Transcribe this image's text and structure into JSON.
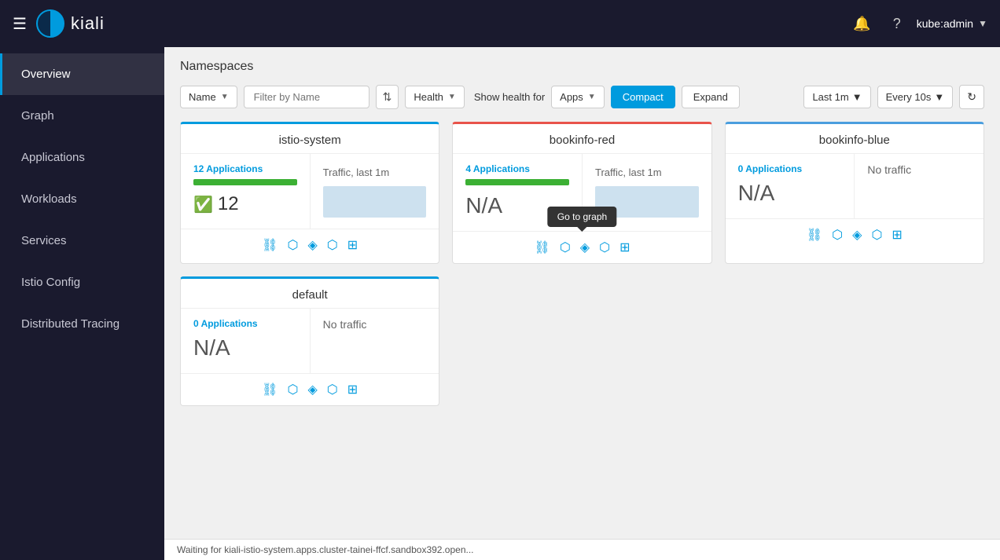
{
  "topnav": {
    "logo_text": "kiali",
    "user": "kube:admin",
    "notification_icon": "🔔",
    "help_icon": "?"
  },
  "sidebar": {
    "items": [
      {
        "id": "overview",
        "label": "Overview",
        "active": true
      },
      {
        "id": "graph",
        "label": "Graph",
        "active": false
      },
      {
        "id": "applications",
        "label": "Applications",
        "active": false
      },
      {
        "id": "workloads",
        "label": "Workloads",
        "active": false
      },
      {
        "id": "services",
        "label": "Services",
        "active": false
      },
      {
        "id": "istio-config",
        "label": "Istio Config",
        "active": false
      },
      {
        "id": "distributed-tracing",
        "label": "Distributed Tracing",
        "active": false
      }
    ]
  },
  "toolbar": {
    "name_label": "Name",
    "filter_placeholder": "Filter by Name",
    "health_label": "Health",
    "show_health_for": "Show health for",
    "apps_label": "Apps",
    "compact_label": "Compact",
    "expand_label": "Expand",
    "last_1m_label": "Last 1m",
    "every_10s_label": "Every 10s"
  },
  "page": {
    "title": "Namespaces"
  },
  "namespaces": [
    {
      "id": "istio-system",
      "name": "istio-system",
      "app_count": 12,
      "app_label": "12 Applications",
      "traffic_label": "Traffic, last 1m",
      "stat": "12",
      "stat_type": "number",
      "has_traffic": true,
      "progress": 100,
      "no_traffic": false
    },
    {
      "id": "bookinfo-red",
      "name": "bookinfo-red",
      "app_count": 4,
      "app_label": "4 Applications",
      "traffic_label": "Traffic, last 1m",
      "stat": "N/A",
      "stat_type": "na",
      "has_traffic": true,
      "progress": 100,
      "no_traffic": false,
      "tooltip": "Go to graph"
    },
    {
      "id": "bookinfo-blue",
      "name": "bookinfo-blue",
      "app_count": 0,
      "app_label": "0 Applications",
      "traffic_label": "",
      "stat": "N/A",
      "stat_type": "na",
      "has_traffic": false,
      "progress": 0,
      "no_traffic": true,
      "no_traffic_label": "No traffic"
    },
    {
      "id": "default",
      "name": "default",
      "app_count": 0,
      "app_label": "0 Applications",
      "traffic_label": "",
      "stat": "N/A",
      "stat_type": "na",
      "has_traffic": false,
      "progress": 0,
      "no_traffic": true,
      "no_traffic_label": "No traffic"
    }
  ],
  "footer": {
    "status_text": "Waiting for kiali-istio-system.apps.cluster-tainei-ffcf.sandbox392.open..."
  },
  "icons": {
    "graph": "⛓",
    "workloads": "⬡",
    "services": "◈",
    "istio": "⬡",
    "table": "⊞"
  }
}
